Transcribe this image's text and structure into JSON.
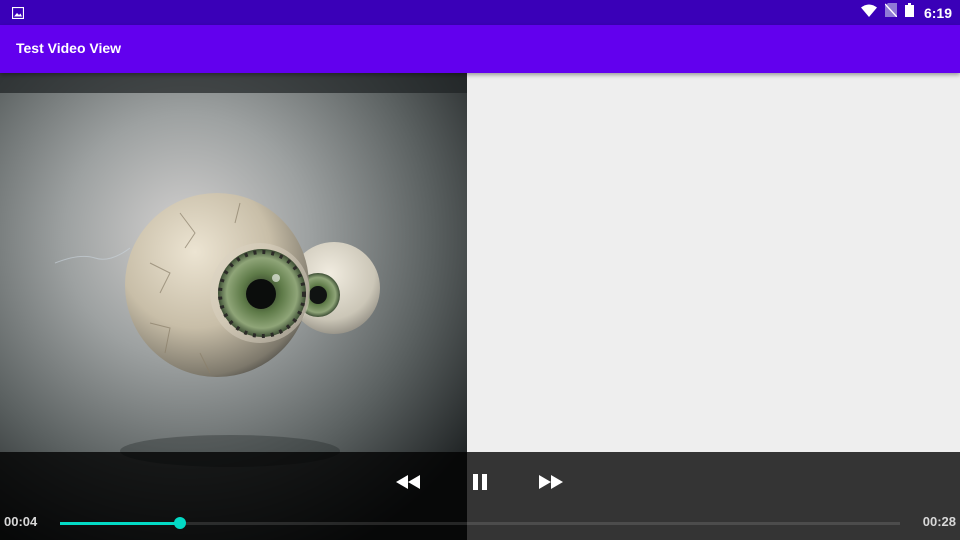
{
  "status_bar": {
    "time": "6:19",
    "icons": [
      "image-notification-icon",
      "wifi-icon",
      "no-sim-icon",
      "battery-icon"
    ]
  },
  "app_bar": {
    "title": "Test Video View",
    "color": "#6200ee"
  },
  "player": {
    "current_time": "00:04",
    "duration": "00:28",
    "progress": 0.143,
    "accent_color": "#03dac5",
    "buttons": [
      "rewind",
      "pause",
      "fast-forward"
    ]
  }
}
